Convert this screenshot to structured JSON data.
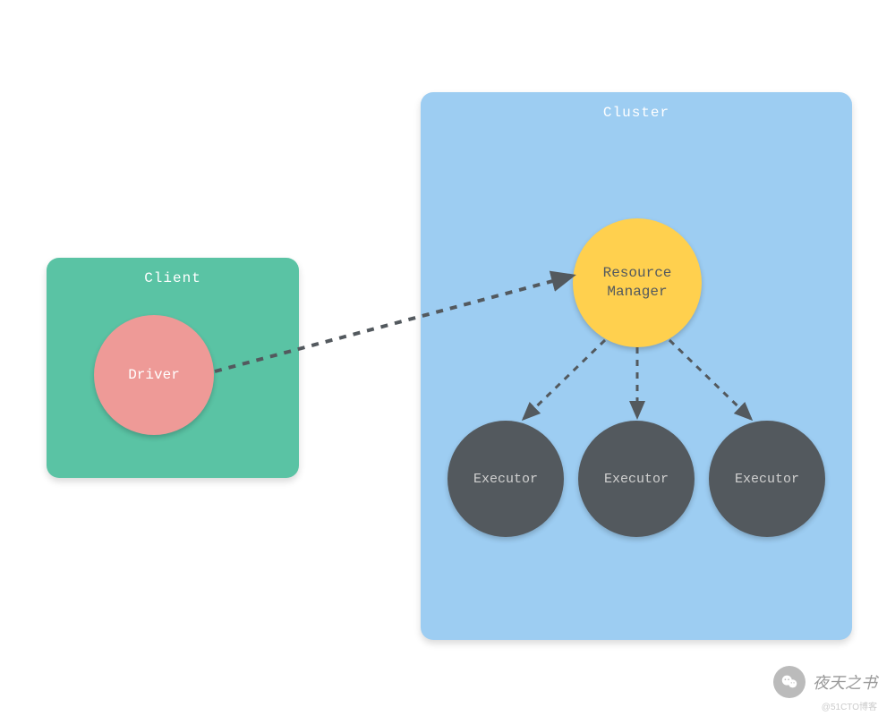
{
  "client": {
    "title": "Client"
  },
  "cluster": {
    "title": "Cluster"
  },
  "nodes": {
    "driver": "Driver",
    "resource_manager_line1": "Resource",
    "resource_manager_line2": "Manager",
    "executor": "Executor"
  },
  "watermark": {
    "text": "夜天之书",
    "sub": "@51CTO博客"
  },
  "diagram": {
    "description": "Spark-like architecture: a Driver inside a Client box connects (dashed arrow) to a Resource Manager inside a Cluster box; the Resource Manager fans out dashed arrows to three Executor nodes.",
    "edges": [
      {
        "from": "Driver",
        "to": "ResourceManager",
        "style": "dashed"
      },
      {
        "from": "ResourceManager",
        "to": "Executor1",
        "style": "dashed"
      },
      {
        "from": "ResourceManager",
        "to": "Executor2",
        "style": "dashed"
      },
      {
        "from": "ResourceManager",
        "to": "Executor3",
        "style": "dashed"
      }
    ],
    "colors": {
      "client_bg": "#5ac3a4",
      "cluster_bg": "#9dcdf2",
      "driver_bg": "#ee9a97",
      "rm_bg": "#ffd04e",
      "executor_bg": "#53595e",
      "arrow": "#53595e"
    }
  }
}
